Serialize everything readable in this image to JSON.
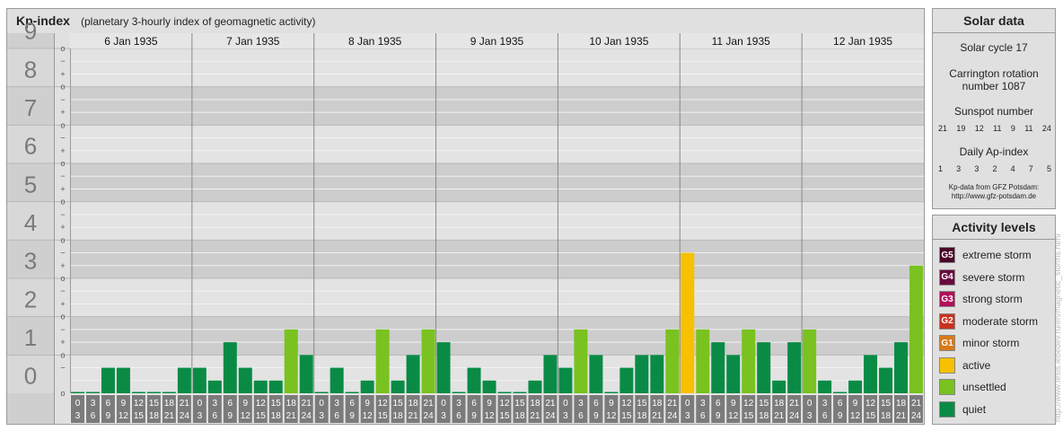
{
  "header": {
    "title": "Kp-index",
    "subtitle": "(planetary 3-hourly index of geomagnetic activity)"
  },
  "chart_data": {
    "type": "bar",
    "ylim": [
      0,
      9
    ],
    "y_major_labels": [
      "0",
      "1",
      "2",
      "3",
      "4",
      "5",
      "6",
      "7",
      "8",
      "9"
    ],
    "y_minor_labels": [
      "−",
      "o",
      "+"
    ],
    "days": [
      "6 Jan 1935",
      "7 Jan 1935",
      "8 Jan 1935",
      "9 Jan 1935",
      "10 Jan 1935",
      "11 Jan 1935",
      "12 Jan 1935"
    ],
    "interval_tops": [
      "0",
      "3",
      "6",
      "9",
      "12",
      "15",
      "18",
      "21"
    ],
    "interval_bottoms": [
      "3",
      "6",
      "9",
      "12",
      "15",
      "18",
      "21",
      "24"
    ],
    "values": [
      0.0,
      0.0,
      0.667,
      0.667,
      0.0,
      0.0,
      0.0,
      0.667,
      0.667,
      0.333,
      1.333,
      0.667,
      0.333,
      0.333,
      1.667,
      1.0,
      0.0,
      0.667,
      0.0,
      0.333,
      1.667,
      0.333,
      1.0,
      1.667,
      1.333,
      0.0,
      0.667,
      0.333,
      0.0,
      0.0,
      0.333,
      1.0,
      0.667,
      1.667,
      1.0,
      0.0,
      0.667,
      1.0,
      1.0,
      1.667,
      3.667,
      1.667,
      1.333,
      1.0,
      1.667,
      1.333,
      0.333,
      1.333,
      1.667,
      0.333,
      0.0,
      0.333,
      1.0,
      0.667,
      1.333,
      3.333
    ]
  },
  "colors": {
    "quiet": "#0a8b45",
    "unsettled": "#79c21f",
    "active": "#f7c000",
    "minor_storm": "#d97a18",
    "moderate_storm": "#c9331e",
    "strong_storm": "#b1105a",
    "severe_storm": "#6a0a3e",
    "extreme_storm": "#4a0428"
  },
  "solar": {
    "title": "Solar data",
    "cycle": "Solar cycle 17",
    "carrington_line1": "Carrington rotation",
    "carrington_line2": "number 1087",
    "sunspot_label": "Sunspot number",
    "sunspot_values": [
      "21",
      "19",
      "12",
      "11",
      "9",
      "11",
      "24"
    ],
    "ap_label": "Daily Ap-index",
    "ap_values": [
      "1",
      "3",
      "3",
      "2",
      "4",
      "7",
      "5"
    ],
    "source_line1": "Kp-data from GFZ Potsdam:",
    "source_line2": "http://www.gfz-potsdam.de"
  },
  "activity": {
    "title": "Activity levels",
    "levels": [
      {
        "badge": "G5",
        "label": "extreme storm",
        "color": "#4a0428"
      },
      {
        "badge": "G4",
        "label": "severe storm",
        "color": "#6a0a3e"
      },
      {
        "badge": "G3",
        "label": "strong storm",
        "color": "#b1105a"
      },
      {
        "badge": "G2",
        "label": "moderate storm",
        "color": "#c9331e"
      },
      {
        "badge": "G1",
        "label": "minor storm",
        "color": "#d97a18"
      },
      {
        "badge": "",
        "label": "active",
        "color": "#f7c000"
      },
      {
        "badge": "",
        "label": "unsettled",
        "color": "#79c21f"
      },
      {
        "badge": "",
        "label": "quiet",
        "color": "#0a8b45"
      }
    ]
  },
  "watermark": "http://www.tesis.lebedev.ru/en/magnetic_storms.html"
}
